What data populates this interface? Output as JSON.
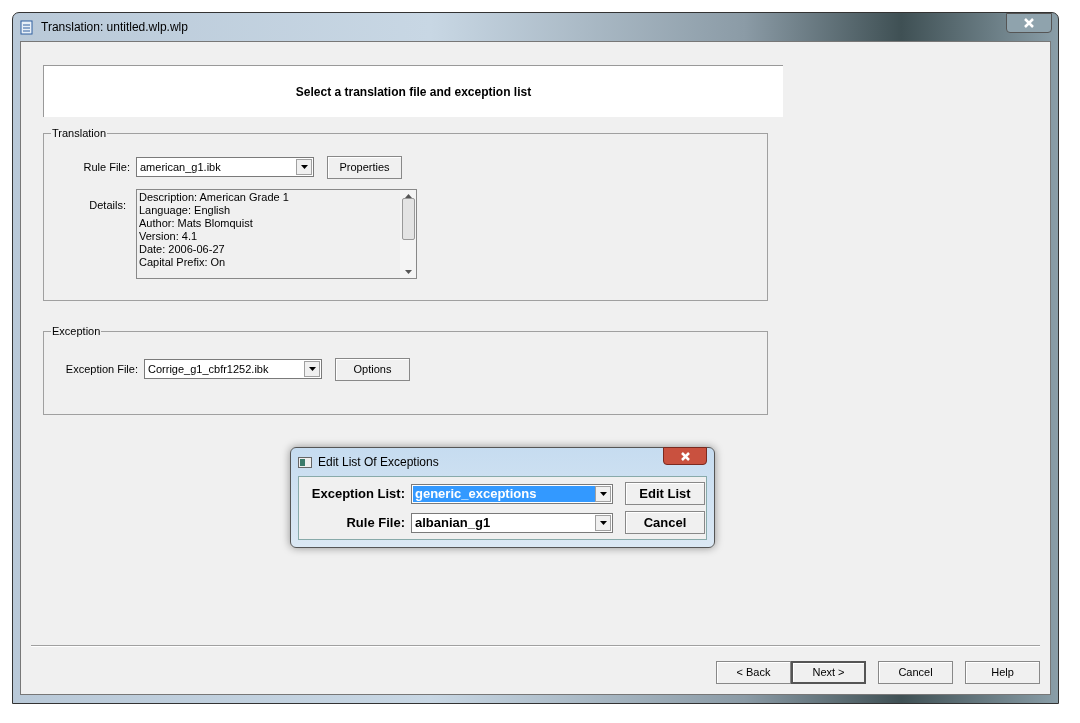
{
  "window": {
    "title": "Translation: untitled.wlp.wlp"
  },
  "header": "Select a translation file and exception list",
  "translation": {
    "legend": "Translation",
    "rule_label": "Rule File:",
    "rule_value": "american_g1.ibk",
    "properties_button": "Properties",
    "details_label": "Details:",
    "details": [
      "Description: American Grade 1",
      "Language: English",
      "Author: Mats Blomquist",
      "Version: 4.1",
      "Date: 2006-06-27",
      "Capital Prefix: On"
    ]
  },
  "exception": {
    "legend": "Exception",
    "file_label": "Exception File:",
    "file_value": "Corrige_g1_cbfr1252.ibk",
    "options_button": "Options"
  },
  "dialog": {
    "title": "Edit List Of Exceptions",
    "fields": [
      {
        "label": "Exception List:",
        "value": "generic_exceptions",
        "highlighted": true,
        "button": "Edit List"
      },
      {
        "label": "Rule File:",
        "value": "albanian_g1",
        "highlighted": false,
        "button": "Cancel"
      }
    ]
  },
  "buttons": [
    {
      "label": "< Back",
      "default": false
    },
    {
      "label": "Next >",
      "default": true
    },
    {
      "label": "Cancel",
      "default": false
    },
    {
      "label": "Help",
      "default": false
    }
  ]
}
